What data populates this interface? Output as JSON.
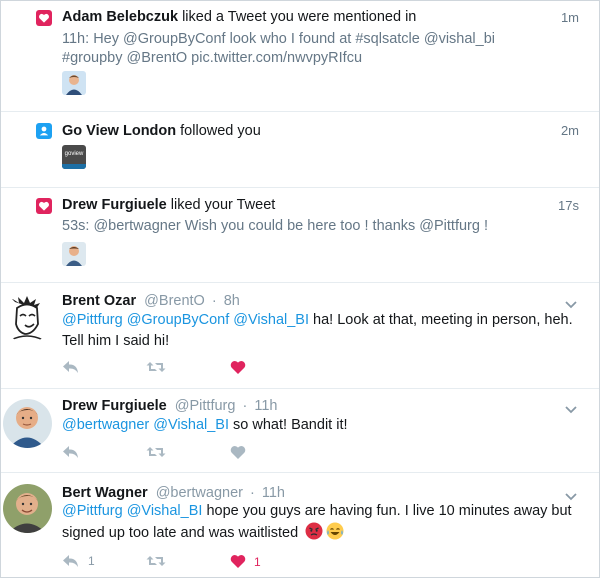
{
  "notifications": [
    {
      "type": "like",
      "actor": "Adam Belebczuk",
      "action": "liked a Tweet you were mentioned in",
      "time": "1m",
      "tweet_prefix": "11h:",
      "tweet_text": "Hey @GroupByConf look who I found at #sqlsatcle @vishal_bi #groupby @BrentO pic.twitter.com/nwvpyRIfcu"
    },
    {
      "type": "follow",
      "actor": "Go View London",
      "action": "followed you",
      "time": "2m",
      "thumb_text": "goview"
    },
    {
      "type": "like",
      "actor": "Drew Furgiuele",
      "action": "liked your Tweet",
      "time": "17s",
      "tweet_prefix": "53s:",
      "tweet_text": "@bertwagner Wish you could be here too ! thanks @Pittfurg !"
    }
  ],
  "tweets": [
    {
      "name": "Brent Ozar",
      "handle": "@BrentO",
      "dot": "·",
      "time": "8h",
      "mentions": [
        "@Pittfurg",
        "@GroupByConf",
        "@Vishal_BI"
      ],
      "text": "ha! Look at that, meeting in person, heh. Tell him I said hi!",
      "liked": true,
      "retweets": "",
      "likes": "",
      "replies": ""
    },
    {
      "name": "Drew Furgiuele",
      "handle": "@Pittfurg",
      "dot": "·",
      "time": "11h",
      "mentions": [
        "@bertwagner",
        "@Vishal_BI"
      ],
      "text": "so what! Bandit it!",
      "liked": false,
      "retweets": "",
      "likes": "",
      "replies": ""
    },
    {
      "name": "Bert Wagner",
      "handle": "@bertwagner",
      "dot": "·",
      "time": "11h",
      "mentions": [
        "@Pittfurg",
        "@Vishal_BI"
      ],
      "text": "hope you guys are having fun. I live 10 minutes away but signed up too late and was waitlisted",
      "emojis": [
        "angry-face",
        "tears-of-joy-face"
      ],
      "liked": true,
      "retweets": "",
      "likes": "1",
      "replies": "1"
    }
  ],
  "colors": {
    "link": "#1b95e0",
    "like": "#e0245e",
    "follow": "#1da1f2",
    "muted": "#8899a6"
  }
}
